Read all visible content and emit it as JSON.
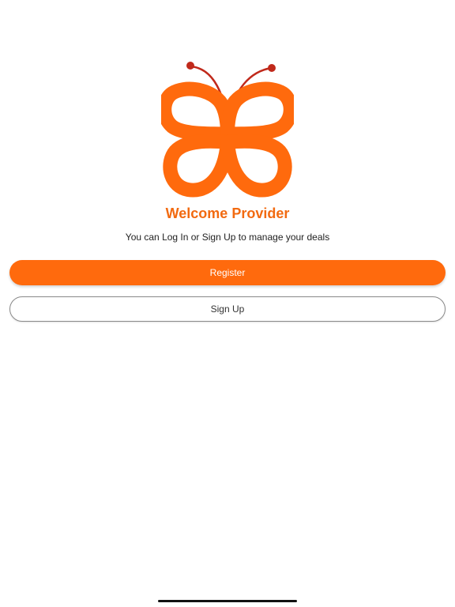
{
  "welcome": {
    "title": "Welcome Provider",
    "subtitle": "You can Log In or Sign Up to manage your deals"
  },
  "buttons": {
    "register_label": "Register",
    "signup_label": "Sign Up"
  },
  "logo": {
    "icon": "butterfly-logo-icon"
  },
  "colors": {
    "brand_orange": "#ff6a0d",
    "title_orange": "#f26a10",
    "antenna_red": "#c0291b",
    "white": "#ffffff"
  }
}
